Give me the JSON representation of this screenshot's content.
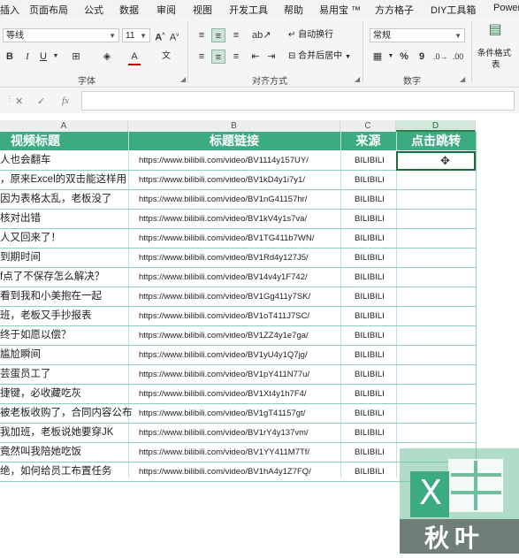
{
  "ribbon_tabs": [
    "插入",
    "页面布局",
    "公式",
    "数据",
    "审阅",
    "视图",
    "开发工具",
    "帮助",
    "易用宝 ™",
    "方方格子",
    "DIY工具箱",
    "Power"
  ],
  "font": {
    "name": "等线",
    "size": "11",
    "group_label": "字体"
  },
  "alignment": {
    "wrap_text": "自动换行",
    "merge_center": "合并后居中",
    "group_label": "对齐方式"
  },
  "number": {
    "format": "常规",
    "group_label": "数字",
    "percent": "%",
    "comma": "9"
  },
  "styles": {
    "conditional_format": "条件格式",
    "table_format_partial": "表"
  },
  "formula_bar": {
    "fx_label": "fx"
  },
  "columns": [
    "A",
    "B",
    "C",
    "D"
  ],
  "header": {
    "title": "视频标题",
    "link": "标题链接",
    "source": "来源",
    "jump": "点击跳转"
  },
  "rows": [
    {
      "title": "人也会翻车",
      "link": "https://www.bilibili.com/video/BV1114y157UY/",
      "source": "BILIBILI"
    },
    {
      "title": "，原来Excel的双击能这样用",
      "link": "https://www.bilibili.com/video/BV1kD4y1i7y1/",
      "source": "BILIBILI"
    },
    {
      "title": "因为表格太乱，老板没了",
      "link": "https://www.bilibili.com/video/BV1nG41157hr/",
      "source": "BILIBILI"
    },
    {
      "title": "核对出错",
      "link": "https://www.bilibili.com/video/BV1kV4y1s7va/",
      "source": "BILIBILI"
    },
    {
      "title": "人又回来了！",
      "link": "https://www.bilibili.com/video/BV1TG411b7WN/",
      "source": "BILIBILI"
    },
    {
      "title": "到期时间",
      "link": "https://www.bilibili.com/video/BV1Rd4y127J5/",
      "source": "BILIBILI"
    },
    {
      "title": "f点了不保存怎么解决？",
      "link": "https://www.bilibili.com/video/BV14v4y1F742/",
      "source": "BILIBILI"
    },
    {
      "title": "看到我和小美抱在一起",
      "link": "https://www.bilibili.com/video/BV1Gg411y7SK/",
      "source": "BILIBILI"
    },
    {
      "title": "班，老板又手抄报表",
      "link": "https://www.bilibili.com/video/BV1oT411J7SC/",
      "source": "BILIBILI"
    },
    {
      "title": "终于如愿以偿？",
      "link": "https://www.bilibili.com/video/BV1ZZ4y1e7ga/",
      "source": "BILIBILI"
    },
    {
      "title": "尴尬瞬间",
      "link": "https://www.bilibili.com/video/BV1yU4y1Q7jg/",
      "source": "BILIBILI"
    },
    {
      "title": "芸蛋员工了",
      "link": "https://www.bilibili.com/video/BV1pY411N77u/",
      "source": "BILIBILI"
    },
    {
      "title": "捷键，必收藏吃灰",
      "link": "https://www.bilibili.com/video/BV1Xt4y1h7F4/",
      "source": "BILIBILI"
    },
    {
      "title": "被老板收购了，合同内容公布",
      "link": "https://www.bilibili.com/video/BV1gT41157gt/",
      "source": "BILIBILI"
    },
    {
      "title": "我加班，老板说她要穿JK",
      "link": "https://www.bilibili.com/video/BV1rY4y137vm/",
      "source": "BILIBILI"
    },
    {
      "title": "竟然叫我陪她吃饭",
      "link": "https://www.bilibili.com/video/BV1YY411M7Tf/",
      "source": "BILIBILI"
    },
    {
      "title": "绝，如何给员工布置任务",
      "link": "https://www.bilibili.com/video/BV1hA4y1Z7FQ/",
      "source": "BILIBILI"
    }
  ],
  "watermark": {
    "text": "秋叶",
    "letter": "X"
  },
  "colors": {
    "header_green": "#3dab82",
    "selection_green": "#1f6b3e",
    "row_border": "#8fd2b7"
  }
}
